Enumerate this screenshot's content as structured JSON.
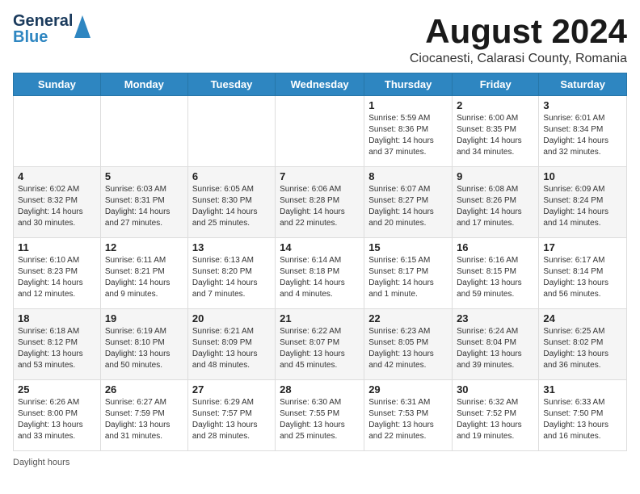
{
  "header": {
    "logo_general": "General",
    "logo_blue": "Blue",
    "main_title": "August 2024",
    "subtitle": "Ciocanesti, Calarasi County, Romania"
  },
  "calendar": {
    "days_of_week": [
      "Sunday",
      "Monday",
      "Tuesday",
      "Wednesday",
      "Thursday",
      "Friday",
      "Saturday"
    ],
    "weeks": [
      [
        {
          "day": "",
          "info": ""
        },
        {
          "day": "",
          "info": ""
        },
        {
          "day": "",
          "info": ""
        },
        {
          "day": "",
          "info": ""
        },
        {
          "day": "1",
          "info": "Sunrise: 5:59 AM\nSunset: 8:36 PM\nDaylight: 14 hours and 37 minutes."
        },
        {
          "day": "2",
          "info": "Sunrise: 6:00 AM\nSunset: 8:35 PM\nDaylight: 14 hours and 34 minutes."
        },
        {
          "day": "3",
          "info": "Sunrise: 6:01 AM\nSunset: 8:34 PM\nDaylight: 14 hours and 32 minutes."
        }
      ],
      [
        {
          "day": "4",
          "info": "Sunrise: 6:02 AM\nSunset: 8:32 PM\nDaylight: 14 hours and 30 minutes."
        },
        {
          "day": "5",
          "info": "Sunrise: 6:03 AM\nSunset: 8:31 PM\nDaylight: 14 hours and 27 minutes."
        },
        {
          "day": "6",
          "info": "Sunrise: 6:05 AM\nSunset: 8:30 PM\nDaylight: 14 hours and 25 minutes."
        },
        {
          "day": "7",
          "info": "Sunrise: 6:06 AM\nSunset: 8:28 PM\nDaylight: 14 hours and 22 minutes."
        },
        {
          "day": "8",
          "info": "Sunrise: 6:07 AM\nSunset: 8:27 PM\nDaylight: 14 hours and 20 minutes."
        },
        {
          "day": "9",
          "info": "Sunrise: 6:08 AM\nSunset: 8:26 PM\nDaylight: 14 hours and 17 minutes."
        },
        {
          "day": "10",
          "info": "Sunrise: 6:09 AM\nSunset: 8:24 PM\nDaylight: 14 hours and 14 minutes."
        }
      ],
      [
        {
          "day": "11",
          "info": "Sunrise: 6:10 AM\nSunset: 8:23 PM\nDaylight: 14 hours and 12 minutes."
        },
        {
          "day": "12",
          "info": "Sunrise: 6:11 AM\nSunset: 8:21 PM\nDaylight: 14 hours and 9 minutes."
        },
        {
          "day": "13",
          "info": "Sunrise: 6:13 AM\nSunset: 8:20 PM\nDaylight: 14 hours and 7 minutes."
        },
        {
          "day": "14",
          "info": "Sunrise: 6:14 AM\nSunset: 8:18 PM\nDaylight: 14 hours and 4 minutes."
        },
        {
          "day": "15",
          "info": "Sunrise: 6:15 AM\nSunset: 8:17 PM\nDaylight: 14 hours and 1 minute."
        },
        {
          "day": "16",
          "info": "Sunrise: 6:16 AM\nSunset: 8:15 PM\nDaylight: 13 hours and 59 minutes."
        },
        {
          "day": "17",
          "info": "Sunrise: 6:17 AM\nSunset: 8:14 PM\nDaylight: 13 hours and 56 minutes."
        }
      ],
      [
        {
          "day": "18",
          "info": "Sunrise: 6:18 AM\nSunset: 8:12 PM\nDaylight: 13 hours and 53 minutes."
        },
        {
          "day": "19",
          "info": "Sunrise: 6:19 AM\nSunset: 8:10 PM\nDaylight: 13 hours and 50 minutes."
        },
        {
          "day": "20",
          "info": "Sunrise: 6:21 AM\nSunset: 8:09 PM\nDaylight: 13 hours and 48 minutes."
        },
        {
          "day": "21",
          "info": "Sunrise: 6:22 AM\nSunset: 8:07 PM\nDaylight: 13 hours and 45 minutes."
        },
        {
          "day": "22",
          "info": "Sunrise: 6:23 AM\nSunset: 8:05 PM\nDaylight: 13 hours and 42 minutes."
        },
        {
          "day": "23",
          "info": "Sunrise: 6:24 AM\nSunset: 8:04 PM\nDaylight: 13 hours and 39 minutes."
        },
        {
          "day": "24",
          "info": "Sunrise: 6:25 AM\nSunset: 8:02 PM\nDaylight: 13 hours and 36 minutes."
        }
      ],
      [
        {
          "day": "25",
          "info": "Sunrise: 6:26 AM\nSunset: 8:00 PM\nDaylight: 13 hours and 33 minutes."
        },
        {
          "day": "26",
          "info": "Sunrise: 6:27 AM\nSunset: 7:59 PM\nDaylight: 13 hours and 31 minutes."
        },
        {
          "day": "27",
          "info": "Sunrise: 6:29 AM\nSunset: 7:57 PM\nDaylight: 13 hours and 28 minutes."
        },
        {
          "day": "28",
          "info": "Sunrise: 6:30 AM\nSunset: 7:55 PM\nDaylight: 13 hours and 25 minutes."
        },
        {
          "day": "29",
          "info": "Sunrise: 6:31 AM\nSunset: 7:53 PM\nDaylight: 13 hours and 22 minutes."
        },
        {
          "day": "30",
          "info": "Sunrise: 6:32 AM\nSunset: 7:52 PM\nDaylight: 13 hours and 19 minutes."
        },
        {
          "day": "31",
          "info": "Sunrise: 6:33 AM\nSunset: 7:50 PM\nDaylight: 13 hours and 16 minutes."
        }
      ]
    ]
  },
  "footer": {
    "daylight_label": "Daylight hours"
  }
}
